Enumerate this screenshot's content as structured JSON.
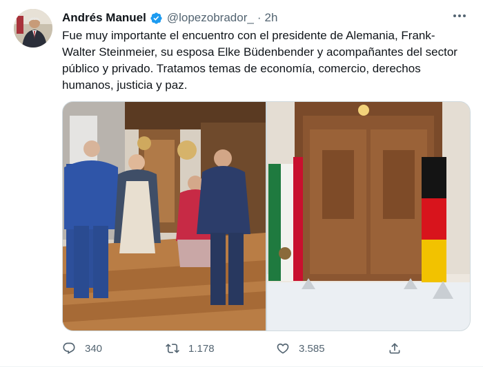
{
  "tweet": {
    "author_name": "Andrés Manuel",
    "handle": "@lopezobrador_",
    "separator": "·",
    "time": "2h",
    "text": "Fue muy importante el encuentro con el presidente de Alemania, Frank-Walter Steinmeier, su esposa Elke Büdenbender y acompañantes del sector público y privado. Tratamos temas de economía, comercio, derechos humanos, justicia y paz.",
    "counts": {
      "replies": "340",
      "retweets": "1.178",
      "likes": "3.585"
    }
  },
  "colors": {
    "verified": "#1d9bf0",
    "muted_text": "#536471",
    "primary_text": "#0f1419"
  },
  "icons": {
    "verified": "verified-badge-icon",
    "more": "more-options-icon",
    "reply": "reply-icon",
    "retweet": "retweet-icon",
    "like": "heart-icon",
    "share": "share-icon"
  }
}
